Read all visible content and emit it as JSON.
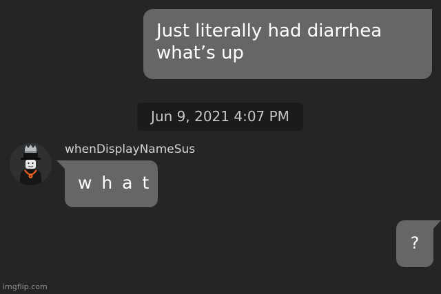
{
  "messages": {
    "outgoing_1": {
      "line_1": "Just literally had diarrhea",
      "line_2": "what’s up"
    },
    "timestamp": "Jun 9, 2021 4:07 PM",
    "incoming": {
      "sender_name": "whenDisplayNameSus",
      "text": "w h a t"
    },
    "outgoing_2": {
      "text": "?"
    }
  },
  "watermark": "imgflip.com",
  "colors": {
    "background": "#232527",
    "bubble": "#656668",
    "timestamp_bg": "#1a1b1c",
    "text": "#ffffff"
  },
  "icons": {
    "avatar": "roblox-avatar-icon"
  }
}
